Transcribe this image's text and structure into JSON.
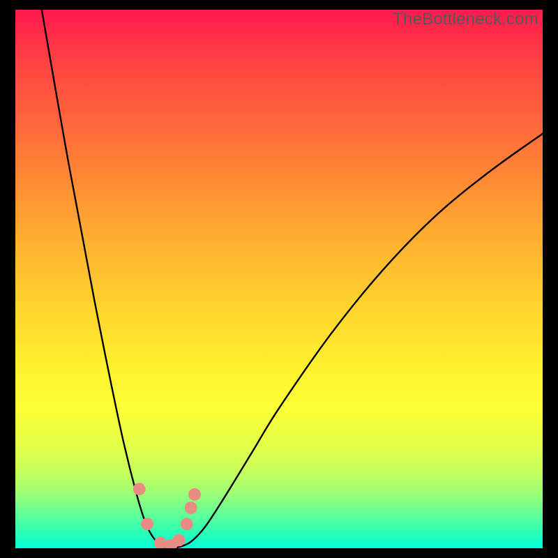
{
  "watermark": "TheBottleneck.com",
  "chart_data": {
    "type": "line",
    "title": "",
    "xlabel": "",
    "ylabel": "",
    "xlim": [
      0,
      100
    ],
    "ylim": [
      0,
      100
    ],
    "grid": false,
    "legend": false,
    "background_gradient": {
      "top_color": "#ff1a4e",
      "bottom_color": "#03ffd8",
      "note": "red (high bottleneck) at top, green (low) at bottom"
    },
    "series": [
      {
        "name": "bottleneck-curve",
        "color": "#000000",
        "x": [
          5,
          10,
          15,
          20,
          23,
          25,
          27,
          29,
          30,
          33,
          36,
          40,
          45,
          50,
          60,
          70,
          80,
          90,
          100
        ],
        "y": [
          100,
          72,
          46,
          22,
          10,
          4,
          1,
          0,
          0,
          1,
          4,
          10,
          18,
          26,
          40,
          52,
          62,
          70,
          77
        ]
      },
      {
        "name": "marker-dots",
        "color": "#e98c84",
        "type": "scatter",
        "x": [
          23.5,
          25.0,
          27.5,
          29.5,
          31.0,
          32.5,
          33.3,
          34.0
        ],
        "y": [
          11,
          4.5,
          1,
          0.5,
          1.5,
          4.5,
          7.5,
          10
        ]
      }
    ],
    "annotations": []
  }
}
